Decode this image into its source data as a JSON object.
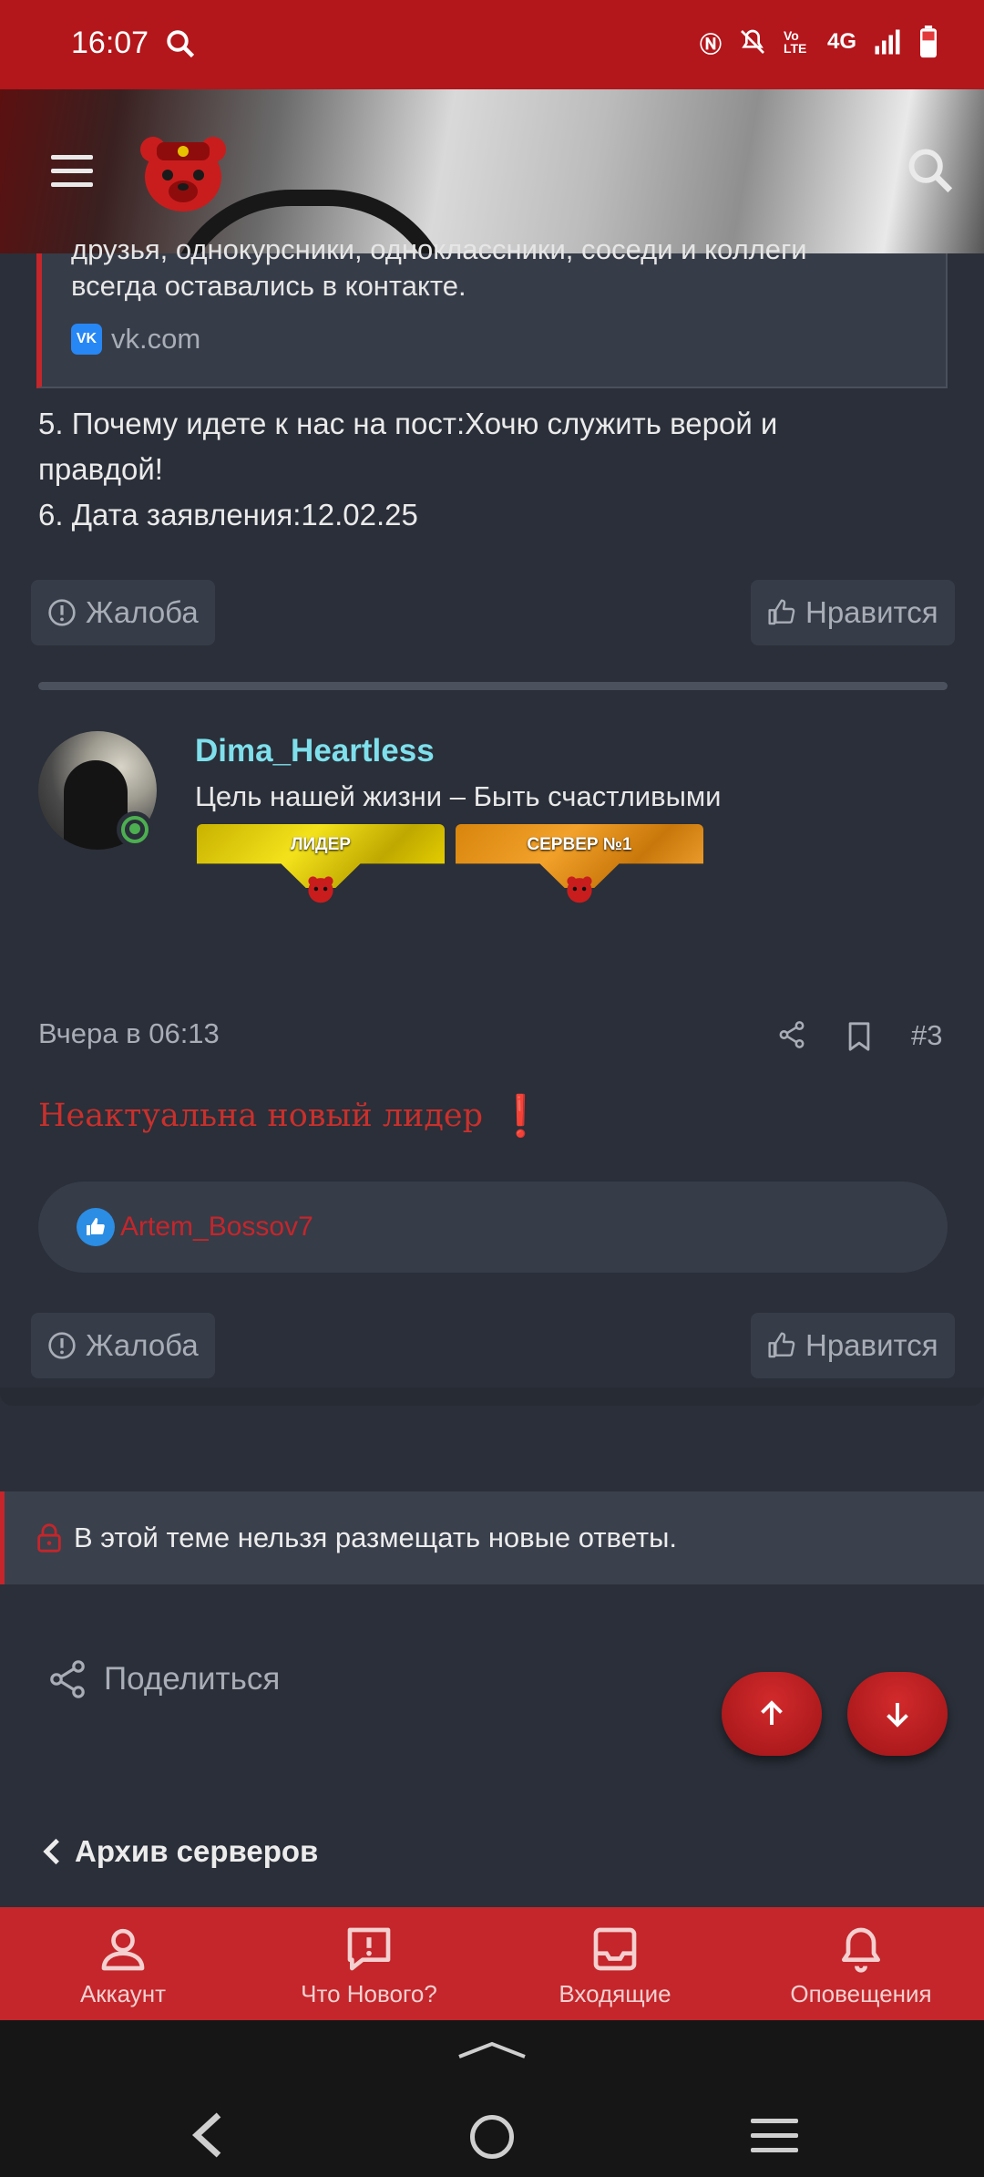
{
  "status_bar": {
    "time": "16:07",
    "icons": [
      "search-icon",
      "nfc-icon",
      "mute-icon",
      "volte-icon",
      "4g-icon",
      "signal-icon",
      "battery-icon"
    ],
    "network_label": "4G",
    "volte_label": "Vo LTE"
  },
  "header": {
    "menu_icon": "hamburger-icon",
    "logo": "bear-logo",
    "search_icon": "search-icon"
  },
  "post_prev": {
    "quote_line1": "друзья, однокурсники, одноклассники, соседи и коллеги",
    "quote_line2": "всегда оставались в контакте.",
    "quote_link": "vk.com",
    "text_lines": [
      "5. Почему идете к нас на пост:Хочю служить верой и",
      "правдой!",
      "6. Дата заявления:12.02.25"
    ],
    "report_label": "Жалоба",
    "like_label": "Нравится"
  },
  "post": {
    "username": "Dima_Heartless",
    "user_title": "Цель нашей жизни – Быть счастливыми",
    "banners": [
      "ЛИДЕР",
      "СЕРВЕР №1"
    ],
    "date": "Вчера в 06:13",
    "number": "#3",
    "body": "Неактуальна новый лидер",
    "body_emoji": "❗",
    "liked_by": "Artem_Bossov7",
    "report_label": "Жалоба",
    "like_label": "Нравится"
  },
  "closed_notice": "В этой теме нельзя размещать новые ответы.",
  "share_label": "Поделиться",
  "breadcrumb": "Архив серверов",
  "bottom_nav": {
    "items": [
      {
        "label": "Аккаунт",
        "icon": "account-icon"
      },
      {
        "label": "Что Нового?",
        "icon": "whats-new-icon"
      },
      {
        "label": "Входящие",
        "icon": "inbox-icon"
      },
      {
        "label": "Оповещения",
        "icon": "bell-icon"
      }
    ]
  },
  "colors": {
    "brand_red": "#c4262b",
    "status_bar": "#b3161b",
    "background": "#2a2f39",
    "card": "#363c48",
    "username": "#7ee0ec"
  }
}
